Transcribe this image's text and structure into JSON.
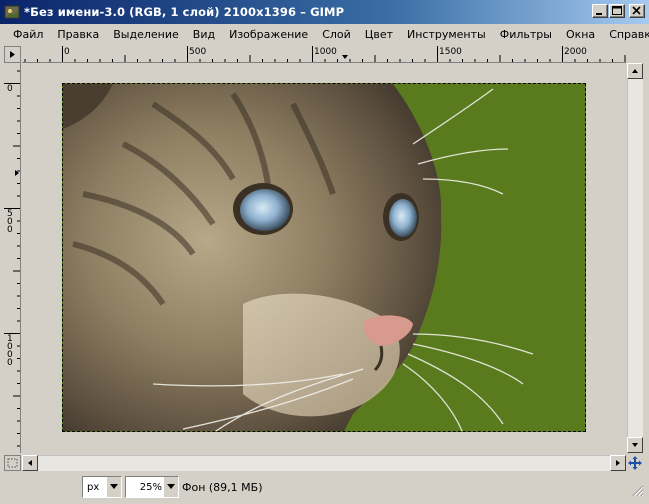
{
  "window": {
    "title": "*Без имени-3.0 (RGB, 1 слой) 2100x1396 – GIMP",
    "minimize_icon": "minimize-icon",
    "maximize_icon": "maximize-icon",
    "close_icon": "close-icon"
  },
  "menu": {
    "items": [
      "Файл",
      "Правка",
      "Выделение",
      "Вид",
      "Изображение",
      "Слой",
      "Цвет",
      "Инструменты",
      "Фильтры",
      "Окна",
      "Справка"
    ]
  },
  "rulers": {
    "horizontal_labels": [
      "0",
      "500",
      "1000",
      "1500",
      "2000"
    ],
    "vertical_labels": [
      "0",
      "500",
      "1000"
    ]
  },
  "statusbar": {
    "unit": "px",
    "zoom": "25%",
    "layer_info": "Фон (89,1 МБ)"
  },
  "colors": {
    "titlebar_start": "#0a246a",
    "titlebar_end": "#a6caf0",
    "background": "#5a7a1e",
    "chrome": "#d4d0c8"
  }
}
